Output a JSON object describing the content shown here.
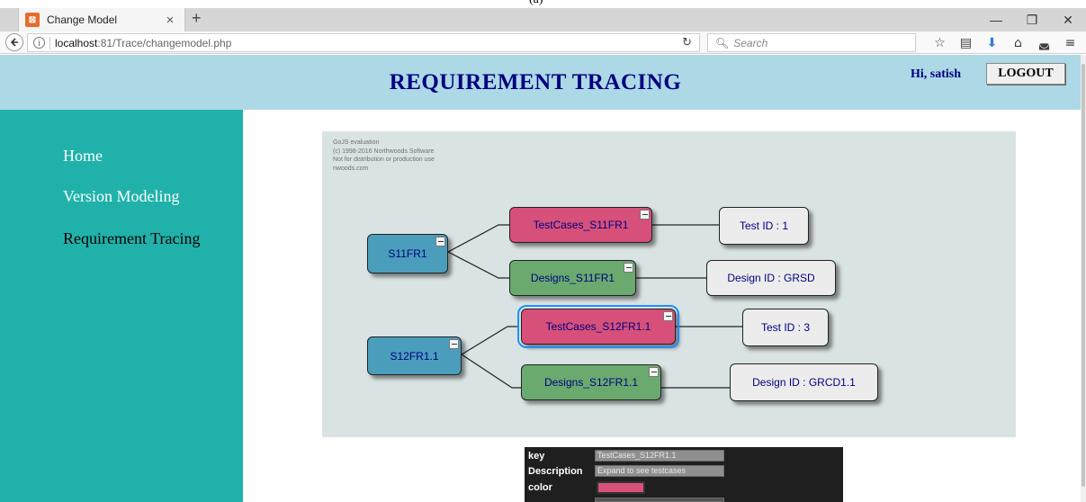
{
  "caption": "(a)",
  "browser": {
    "tab_title": "Change Model",
    "tab_favicon": "xampp-icon",
    "tab_close": "×",
    "new_tab": "+",
    "url_prefix": "localhost",
    "url_rest": ":81/Trace/changemodel.php",
    "search_placeholder": "Search",
    "window_minimize": "—",
    "window_restore": "❐",
    "window_close": "✕"
  },
  "header": {
    "title": "REQUIREMENT TRACING",
    "greeting": "Hi, satish",
    "logout_label": "LOGOUT",
    "bg_color": "#add8e6",
    "title_color": "#000080"
  },
  "sidebar": {
    "bg_color": "#20b2aa",
    "items": [
      {
        "label": "Home"
      },
      {
        "label": "Version Modeling"
      },
      {
        "label": "Requirement Tracing"
      }
    ]
  },
  "diagram": {
    "watermark": [
      "GoJS evaluation",
      "(c) 1998-2016 Northwoods Software",
      "Not for distribution or production use",
      "nwoods.com"
    ],
    "nodes": [
      {
        "key": "S11FR1",
        "color": "#4a9ebb"
      },
      {
        "key": "TestCases_S11FR1",
        "color": "#d6507a"
      },
      {
        "key": "Designs_S11FR1",
        "color": "#6aaa6e"
      },
      {
        "key": "Test ID : 1",
        "color": "#ececec"
      },
      {
        "key": "Design ID : GRSD",
        "color": "#ececec"
      },
      {
        "key": "S12FR1.1",
        "color": "#4a9ebb"
      },
      {
        "key": "TestCases_S12FR1.1",
        "color": "#d6507a",
        "selected": true
      },
      {
        "key": "Designs_S12FR1.1",
        "color": "#6aaa6e"
      },
      {
        "key": "Test ID : 3",
        "color": "#ececec"
      },
      {
        "key": "Design ID : GRCD1.1",
        "color": "#ececec"
      }
    ]
  },
  "inspector": {
    "key_label": "key",
    "key_value": "TestCases_S12FR1.1",
    "description_label": "Description",
    "description_value": "Expand to see testcases",
    "color_label": "color",
    "color_value": "#d6507a"
  }
}
